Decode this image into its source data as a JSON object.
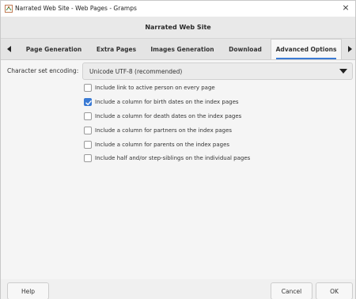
{
  "window": {
    "title": "Narrated Web Site - Web Pages - Gramps",
    "close_glyph": "×",
    "app_icon": "gramps-tree-icon",
    "close_icon": "close-icon"
  },
  "dialog": {
    "title": "Narrated Web Site"
  },
  "tabs": [
    {
      "label": "Page Generation"
    },
    {
      "label": "Extra Pages"
    },
    {
      "label": "Images Generation"
    },
    {
      "label": "Download"
    },
    {
      "label": "Advanced Options",
      "active": true
    }
  ],
  "tab_scroll": {
    "left_icon": "triangle-left-icon",
    "right_icon": "triangle-right-icon"
  },
  "encoding": {
    "label": "Character set encoding:",
    "value": "Unicode UTF-8 (recommended)",
    "arrow_icon": "triangle-down-icon"
  },
  "options": [
    {
      "label": "Include link to active person on every page",
      "checked": false
    },
    {
      "label": "Include a column for birth dates on the index pages",
      "checked": true
    },
    {
      "label": "Include a column for death dates on the index pages",
      "checked": false
    },
    {
      "label": "Include a column for partners on the index pages",
      "checked": false
    },
    {
      "label": "Include a column for parents on the index pages",
      "checked": false
    },
    {
      "label": "Include half and/or step-siblings on the individual pages",
      "checked": false
    }
  ],
  "buttons": {
    "help": "Help",
    "cancel": "Cancel",
    "ok": "OK"
  },
  "colors": {
    "accent": "#3a7ad4",
    "background": "#f5f5f5",
    "header": "#e9e9e9"
  }
}
